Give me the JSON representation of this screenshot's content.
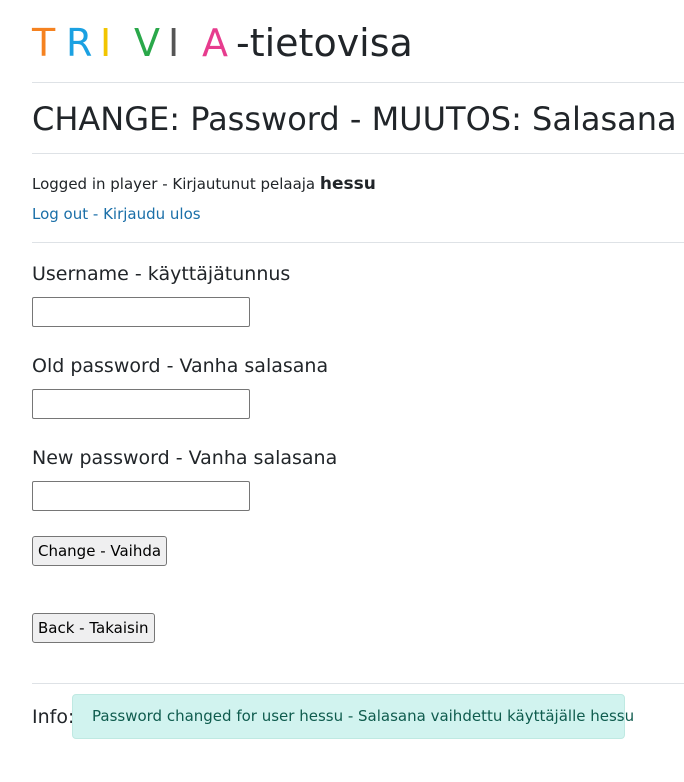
{
  "header": {
    "logo_letters": [
      {
        "char": "T",
        "color": "#f58220"
      },
      {
        "char": "R",
        "color": "#1ba1e2"
      },
      {
        "char": "I",
        "color": "#f2c500"
      },
      {
        "char": "V",
        "color": "#2aa84a"
      },
      {
        "char": "I",
        "color": "#555555"
      },
      {
        "char": "A",
        "color": "#e73c8e"
      }
    ],
    "logo_suffix": "-tietovisa"
  },
  "page_title": "CHANGE: Password - MUUTOS: Salasana",
  "session": {
    "logged_in_text": "Logged in player - Kirjautunut pelaaja",
    "username": "hessu",
    "logout_label": "Log out - Kirjaudu ulos"
  },
  "form": {
    "username_label": "Username - käyttäjätunnus",
    "username_value": "",
    "old_password_label": "Old password - Vanha salasana",
    "old_password_value": "",
    "new_password_label": "New password - Vanha salasana",
    "new_password_value": "",
    "submit_label": "Change - Vaihda"
  },
  "back_label": "Back - Takaisin",
  "info": {
    "label": "Info:",
    "message": "Password changed for user hessu - Salasana vaihdettu käyttäjälle hessu"
  }
}
